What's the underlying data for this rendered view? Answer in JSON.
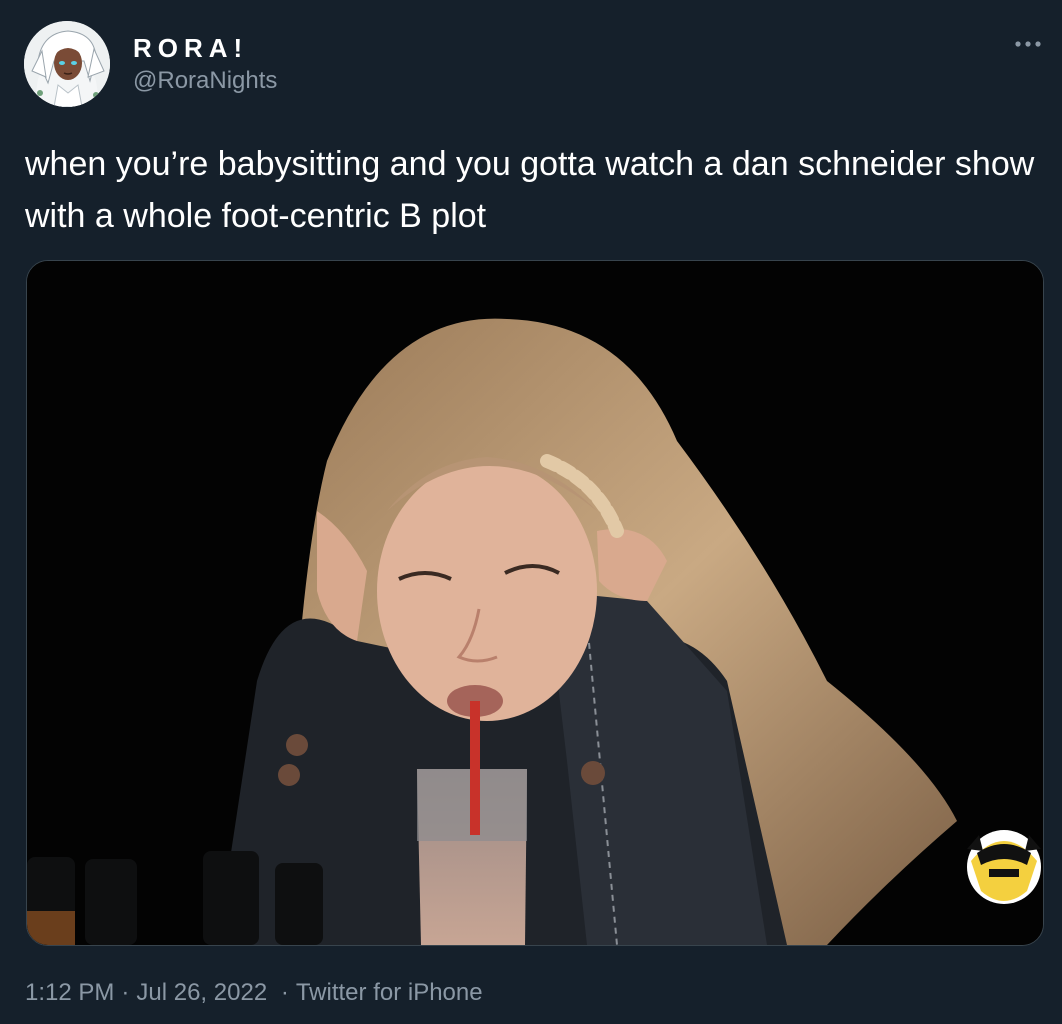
{
  "author": {
    "display_name": "RORA!",
    "handle": "@RoraNights",
    "avatar_icon": "anime-character-avatar"
  },
  "more_icon": "more-horizontal-icon",
  "tweet": {
    "text": "when you’re babysitting and you gotta watch a dan schneider show with a whole foot-centric B plot"
  },
  "media": {
    "type": "photo",
    "watermark_icon": "hot-ones-logo-icon"
  },
  "meta": {
    "time": "1:12 PM",
    "separator": "·",
    "date": "Jul 26, 2022",
    "source": "Twitter for iPhone"
  },
  "colors": {
    "background": "#15202b",
    "secondary_text": "#8b98a5",
    "border": "#38444d"
  }
}
